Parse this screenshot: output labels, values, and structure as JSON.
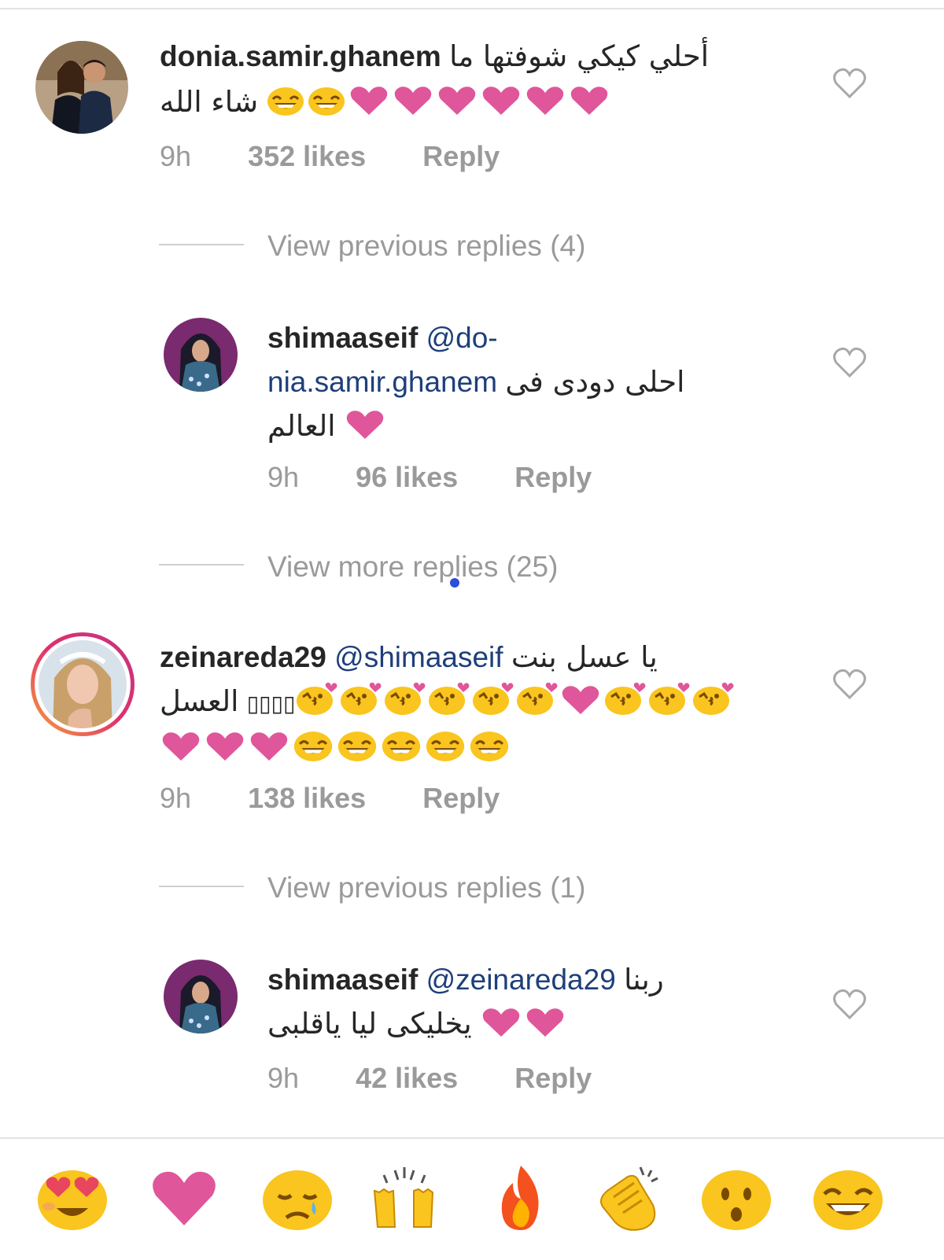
{
  "comments": [
    {
      "username": "donia.samir.ghanem",
      "text_line1": "أحلي كيكي شوفتها ما",
      "text_line2_end": "شاء الله",
      "time": "9h",
      "likes": "352 likes",
      "reply": "Reply"
    },
    {
      "username": "shimaaseif",
      "mention_part1": "@do-",
      "mention_part2": "nia.samir.ghanem",
      "text_line2": "احلى دودى فى",
      "text_line3": "العالم",
      "time": "9h",
      "likes": "96 likes",
      "reply": "Reply"
    },
    {
      "username": "zeinareda29",
      "mention": "@shimaaseif",
      "text_line1": "يا عسل بنت",
      "text_line2": "العسل",
      "text_boxes": "▯▯▯▯",
      "time": "9h",
      "likes": "138 likes",
      "reply": "Reply"
    },
    {
      "username": "shimaaseif",
      "mention": "@zeinareda29",
      "text_line1": "ربنا",
      "text_line2": "يخليكى ليا ياقلبى",
      "time": "9h",
      "likes": "42 likes",
      "reply": "Reply"
    }
  ],
  "view_replies": [
    "View previous replies (4)",
    "View more replies (25)",
    "View previous replies (1)"
  ],
  "quick_emojis": [
    "heart-eyes",
    "pink-heart",
    "crying",
    "raised-hands",
    "fire",
    "clapping",
    "surprised",
    "tears-of-joy"
  ],
  "colors": {
    "heart": "#e0569a",
    "emoji_yellow": "#f9c51e",
    "mention": "#1e3f7a",
    "meta_gray": "#9a9a9a",
    "story_ring": "#e1306c"
  }
}
